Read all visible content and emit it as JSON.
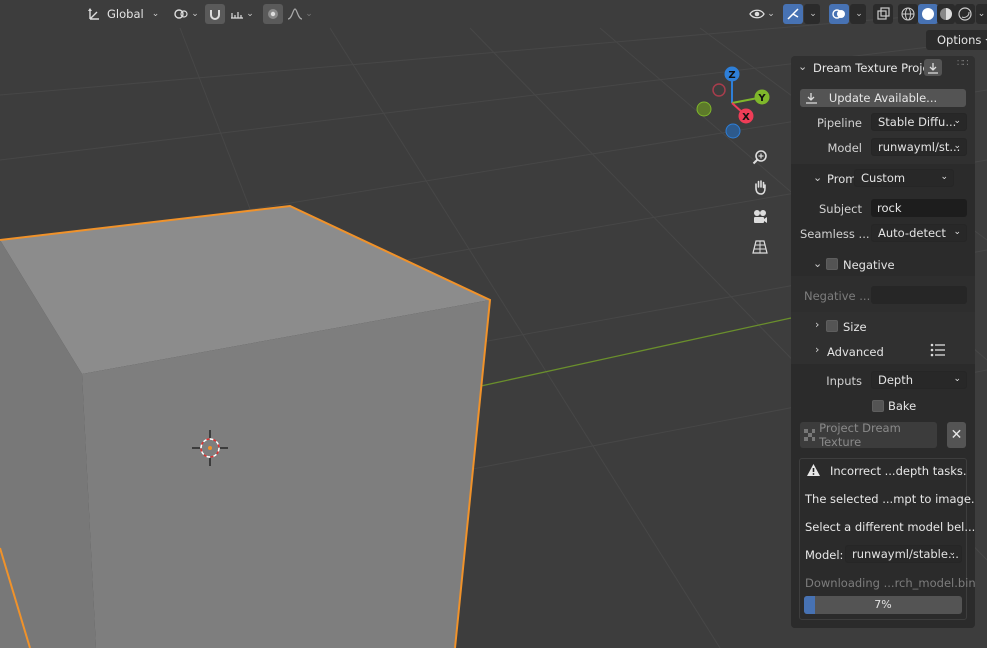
{
  "header": {
    "transform_orientation": "Global",
    "options_label": "Options"
  },
  "gizmo": {
    "z": "Z",
    "y": "Y",
    "x": "X"
  },
  "panel": {
    "title": "Dream Texture Projec",
    "update_button": "Update Available...",
    "pipeline_label": "Pipeline",
    "pipeline_value": "Stable Diffu...",
    "model_label": "Model",
    "model_value": "runwayml/st...",
    "prompt_label": "Prom",
    "prompt_value": "Custom",
    "subject_label": "Subject",
    "subject_value": "rock",
    "seamless_label": "Seamless ...",
    "seamless_value": "Auto-detect",
    "negative_label": "Negative",
    "negative_field_label": "Negative ...",
    "negative_field_value": "",
    "size_label": "Size",
    "advanced_label": "Advanced",
    "inputs_label": "Inputs",
    "inputs_value": "Depth",
    "bake_label": "Bake",
    "project_button": "Project Dream Texture",
    "warning_title": "Incorrect ...depth tasks.",
    "warning_line1": "The selected ...mpt to image.",
    "warning_line2": "Select a different model bel...",
    "warning_model_label": "Model:",
    "warning_model_value": "runwayml/stable...",
    "download_text": "Downloading ...rch_model.bin",
    "progress_text": "7%",
    "progress_fraction": 0.07
  },
  "colors": {
    "selection_outline": "#f0922a",
    "accent_blue": "#4772b3",
    "axis_z": "#2e7fd8",
    "axis_y": "#7fb72b",
    "axis_x": "#ef3d57"
  }
}
